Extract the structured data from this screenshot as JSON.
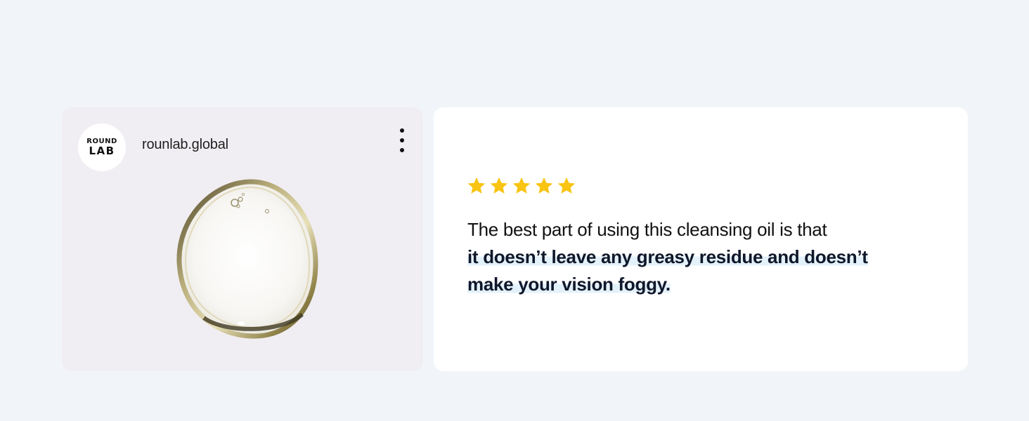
{
  "post": {
    "logo_line1": "ROUND",
    "logo_line2": "LAB",
    "account_name": "rounlab.global",
    "more_icon": "more-vertical-icon"
  },
  "review": {
    "rating": 5,
    "rating_max": 5,
    "star_color": "#f9c412",
    "text_plain": "The best part of using this cleansing oil is that",
    "text_highlight": "it doesn’t leave any greasy residue and doesn’t make your vision foggy."
  },
  "colors": {
    "background": "#f1f5f9",
    "post_card_bg": "#f0eef2",
    "review_card_bg": "#ffffff",
    "highlight": "#e3f1fa"
  }
}
